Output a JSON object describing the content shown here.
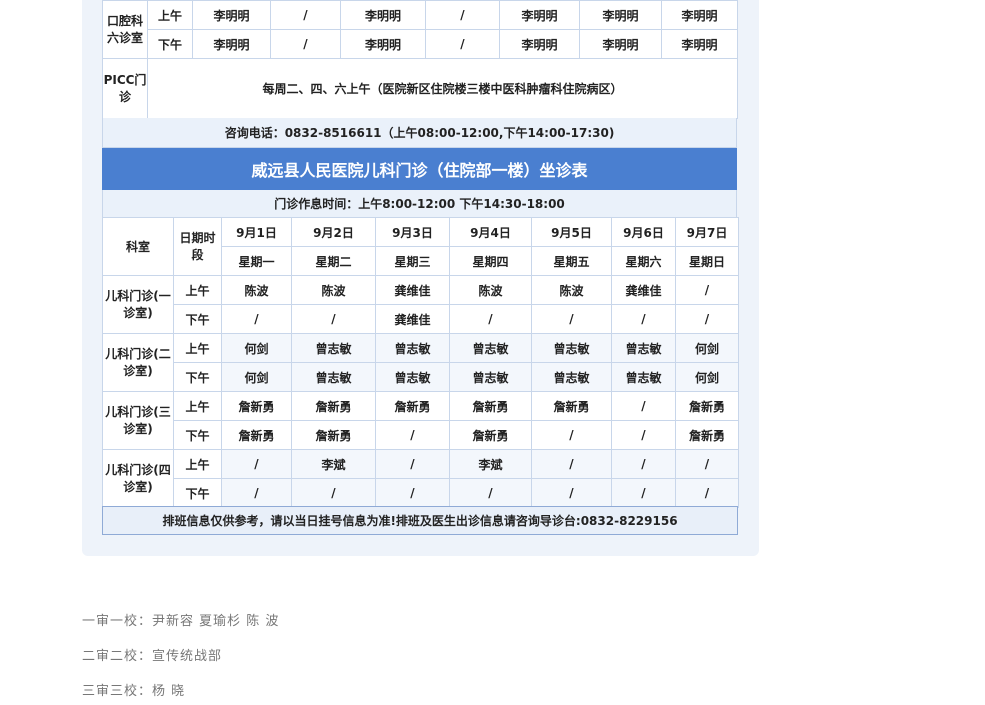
{
  "top_table": {
    "dept": "口腔科六诊室",
    "am": "上午",
    "pm": "下午",
    "am_cells": [
      "李明明",
      "/",
      "李明明",
      "/",
      "李明明",
      "李明明",
      "李明明"
    ],
    "pm_cells": [
      "李明明",
      "/",
      "李明明",
      "/",
      "李明明",
      "李明明",
      "李明明"
    ],
    "picc_dept": "PICC门诊",
    "picc_text": "每周二、四、六上午（医院新区住院楼三楼中医科肿瘤科住院病区）"
  },
  "phone_line": "咨询电话：0832-8516611（上午08:00-12:00,下午14:00-17:30)",
  "title": "威远县人民医院儿科门诊（住院部一楼）坐诊表",
  "hours_line": "门诊作息时间：上午8:00-12:00  下午14:30-18:00",
  "header": {
    "dept": "科室",
    "date_period": "日期时段",
    "dates": [
      "9月1日",
      "9月2日",
      "9月3日",
      "9月4日",
      "9月5日",
      "9月6日",
      "9月7日"
    ],
    "weekdays": [
      "星期一",
      "星期二",
      "星期三",
      "星期四",
      "星期五",
      "星期六",
      "星期日"
    ]
  },
  "rooms": [
    {
      "name": "儿科门诊(一诊室)",
      "am": [
        "陈波",
        "陈波",
        "龚维佳",
        "陈波",
        "陈波",
        "龚维佳",
        "/"
      ],
      "pm": [
        "/",
        "/",
        "龚维佳",
        "/",
        "/",
        "/",
        "/"
      ]
    },
    {
      "name": "儿科门诊(二诊室)",
      "am": [
        "何剑",
        "曾志敏",
        "曾志敏",
        "曾志敏",
        "曾志敏",
        "曾志敏",
        "何剑"
      ],
      "pm": [
        "何剑",
        "曾志敏",
        "曾志敏",
        "曾志敏",
        "曾志敏",
        "曾志敏",
        "何剑"
      ]
    },
    {
      "name": "儿科门诊(三诊室)",
      "am": [
        "詹新勇",
        "詹新勇",
        "詹新勇",
        "詹新勇",
        "詹新勇",
        "/",
        "詹新勇"
      ],
      "pm": [
        "詹新勇",
        "詹新勇",
        "/",
        "詹新勇",
        "/",
        "/",
        "詹新勇"
      ]
    },
    {
      "name": "儿科门诊(四诊室)",
      "am": [
        "/",
        "李斌",
        "/",
        "李斌",
        "/",
        "/",
        "/"
      ],
      "pm": [
        "/",
        "/",
        "/",
        "/",
        "/",
        "/",
        "/"
      ]
    }
  ],
  "am": "上午",
  "pm": "下午",
  "note": "排班信息仅供参考，请以当日挂号信息为准!排班及医生出诊信息请咨询导诊台:0832-8229156",
  "review": [
    "一审一校：尹新容 夏瑜杉 陈 波",
    "二审二校：宣传统战部",
    "三审三校：杨  晓"
  ]
}
